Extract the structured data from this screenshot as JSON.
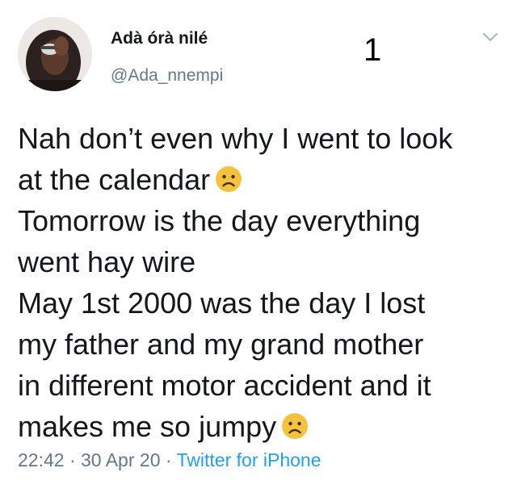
{
  "user": {
    "display_name": "Adà órà nilé",
    "handle": "@Ada_nnempi"
  },
  "overlay_number": "1",
  "tweet": {
    "lines": [
      "Nah don’t even why I went to look",
      "at the calendar",
      "Tomorrow is the day everything",
      "went hay wire",
      "May 1st 2000 was the day I lost",
      "my father and my grand mother",
      "in different motor accident and it",
      "makes me so jumpy"
    ],
    "emoji": "sad-face-icon"
  },
  "meta": {
    "time": "22:42",
    "separator": " · ",
    "date": "30 Apr 20",
    "source": "Twitter for iPhone"
  },
  "colors": {
    "text": "#14171a",
    "muted": "#657786",
    "link": "#1da1f2",
    "emoji": "#f5c33b"
  }
}
